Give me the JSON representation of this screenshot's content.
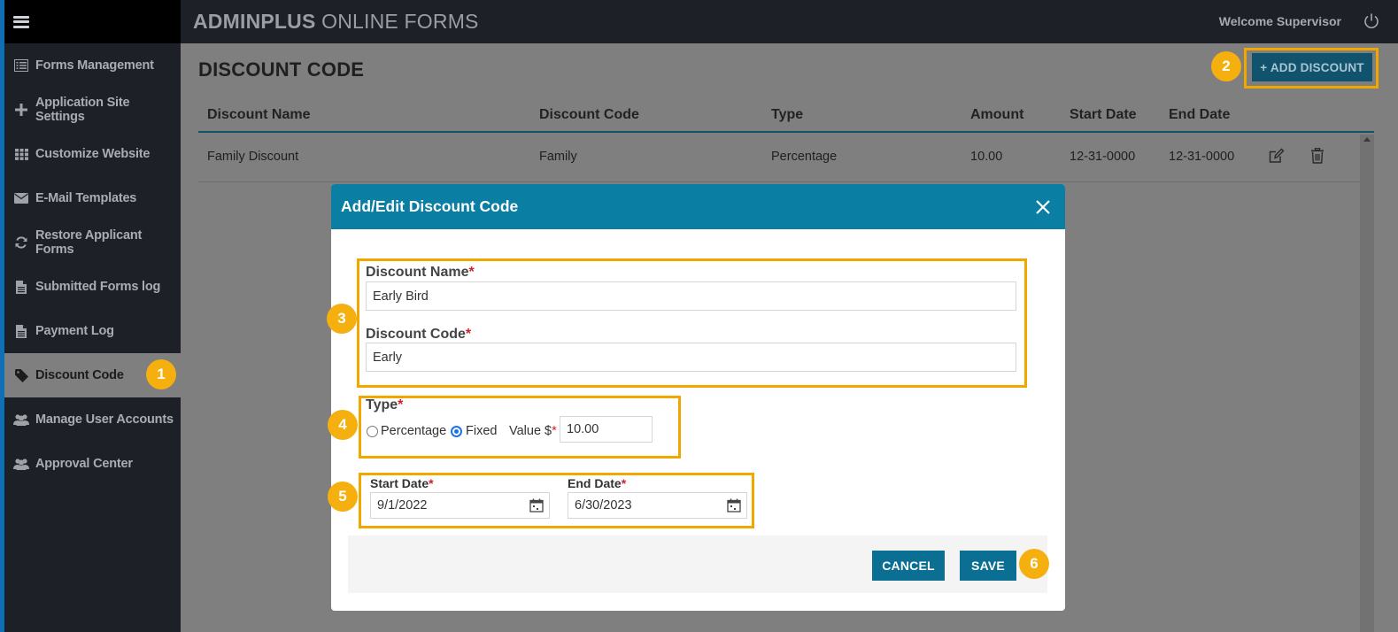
{
  "app": {
    "title_bold": "ADMINPLUS",
    "title_rest": " ONLINE FORMS",
    "welcome": "Welcome Supervisor"
  },
  "sidebar": {
    "items": [
      {
        "label": "Forms Management",
        "icon": "list-icon"
      },
      {
        "label": "Application Site Settings",
        "icon": "plus-icon"
      },
      {
        "label": "Customize Website",
        "icon": "grid-icon"
      },
      {
        "label": "E-Mail Templates",
        "icon": "envelope-icon"
      },
      {
        "label": "Restore Applicant Forms",
        "icon": "refresh-icon"
      },
      {
        "label": "Submitted Forms log",
        "icon": "document-icon"
      },
      {
        "label": "Payment Log",
        "icon": "document-icon"
      },
      {
        "label": "Discount Code",
        "icon": "tag-icon",
        "active": true
      },
      {
        "label": "Manage User Accounts",
        "icon": "users-icon"
      },
      {
        "label": "Approval Center",
        "icon": "users-icon"
      }
    ]
  },
  "page": {
    "title": "DISCOUNT CODE",
    "add_button": "+ ADD DISCOUNT",
    "table": {
      "headers": [
        "Discount Name",
        "Discount Code",
        "Type",
        "Amount",
        "Start Date",
        "End Date"
      ],
      "rows": [
        [
          "Family Discount",
          "Family",
          "Percentage",
          "10.00",
          "12-31-0000",
          "12-31-0000"
        ]
      ]
    }
  },
  "modal": {
    "title": "Add/Edit Discount Code",
    "discount_name_label": "Discount Name",
    "discount_name_value": "Early Bird",
    "discount_code_label": "Discount Code",
    "discount_code_value": "Early",
    "type_label": "Type",
    "type_options": [
      "Percentage",
      "Fixed"
    ],
    "type_selected": "Fixed",
    "value_label": "Value $",
    "value": "10.00",
    "start_date_label": "Start Date",
    "start_date_value": "9/1/2022",
    "end_date_label": "End Date",
    "end_date_value": "6/30/2023",
    "required_mark": "*",
    "cancel": "CANCEL",
    "save": "SAVE"
  },
  "badges": [
    "1",
    "2",
    "3",
    "4",
    "5",
    "6"
  ],
  "colors": {
    "accent": "#0b7ea3",
    "highlight": "#f0a800",
    "button": "#0b6e93"
  }
}
